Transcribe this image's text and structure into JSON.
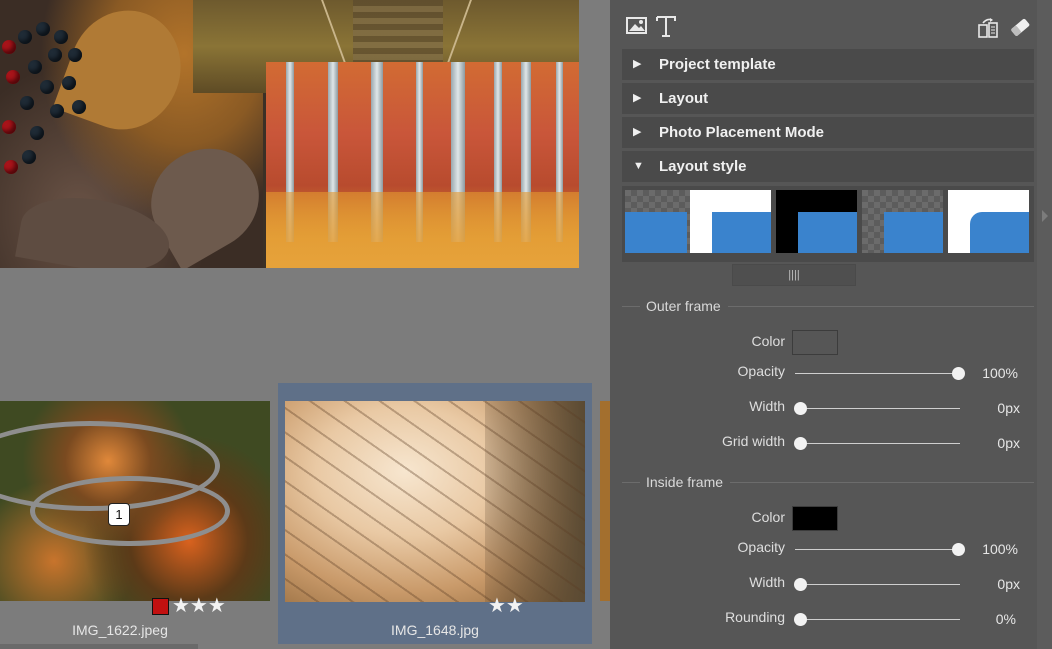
{
  "filmstrip": {
    "items": [
      {
        "filename": "IMG_1622.jpeg",
        "number": "1",
        "stars": "★★★",
        "color_label": "#c21010"
      },
      {
        "filename": "IMG_1648.jpg",
        "stars": "★★",
        "selected": true
      }
    ]
  },
  "panel": {
    "sections": [
      {
        "label": "Project template",
        "expanded": false
      },
      {
        "label": "Layout",
        "expanded": false
      },
      {
        "label": "Photo Placement Mode",
        "expanded": false
      },
      {
        "label": "Layout style",
        "expanded": true
      }
    ],
    "scroll_handle": "||||",
    "outer_frame": {
      "title": "Outer frame",
      "color_label": "Color",
      "color_value": "#565656",
      "opacity_label": "Opacity",
      "opacity_value": "100%",
      "opacity_fraction": 1.0,
      "width_label": "Width",
      "width_value": "0px",
      "width_fraction": 0,
      "grid_width_label": "Grid width",
      "grid_width_value": "0px",
      "grid_width_fraction": 0
    },
    "inside_frame": {
      "title": "Inside frame",
      "color_label": "Color",
      "color_value": "#000000",
      "opacity_label": "Opacity",
      "opacity_value": "100%",
      "opacity_fraction": 1.0,
      "width_label": "Width",
      "width_value": "0px",
      "width_fraction": 0,
      "rounding_label": "Rounding",
      "rounding_value": "0%",
      "rounding_fraction": 0
    }
  },
  "colors": {
    "accent_blue": "#3a83cd",
    "selection": "#5f7088",
    "panel_bg": "#565656"
  },
  "icons": [
    "image-icon",
    "text-icon",
    "swap-layout-icon",
    "eraser-icon",
    "chevron-right-icon"
  ]
}
